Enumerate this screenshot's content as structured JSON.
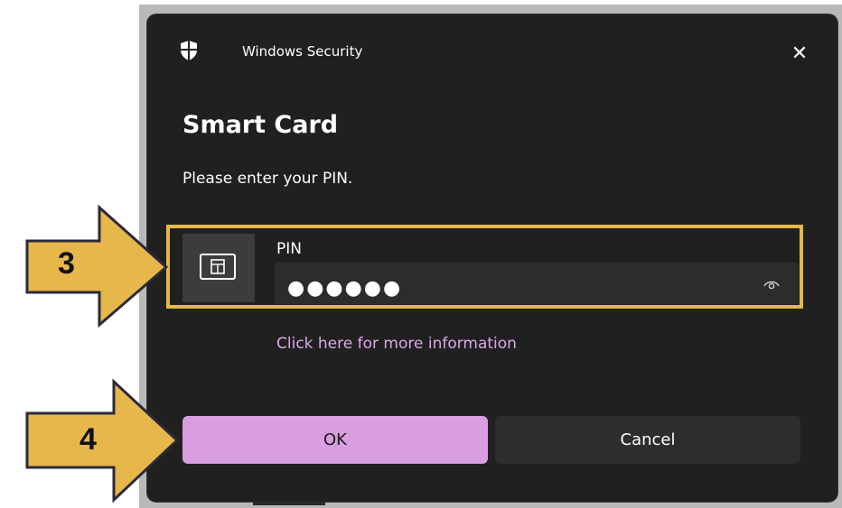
{
  "dialog": {
    "title": "Windows Security",
    "close_label": "✕",
    "heading": "Smart Card",
    "prompt": "Please enter your PIN.",
    "pin_label": "PIN",
    "pin_value": "●●●●●●",
    "more_info_link": "Click here for more information",
    "ok_label": "OK",
    "cancel_label": "Cancel"
  },
  "annotations": {
    "step_a": "3",
    "step_b": "4"
  },
  "icons": {
    "title_icon": "shield-icon",
    "card_icon": "smart-card-icon",
    "reveal_icon": "eye-icon"
  },
  "colors": {
    "dialog_bg": "#202020",
    "accent_button": "#d89ee0",
    "link": "#dba8e8",
    "callout": "#e6b84b",
    "callout_border": "#2a2a3a"
  }
}
